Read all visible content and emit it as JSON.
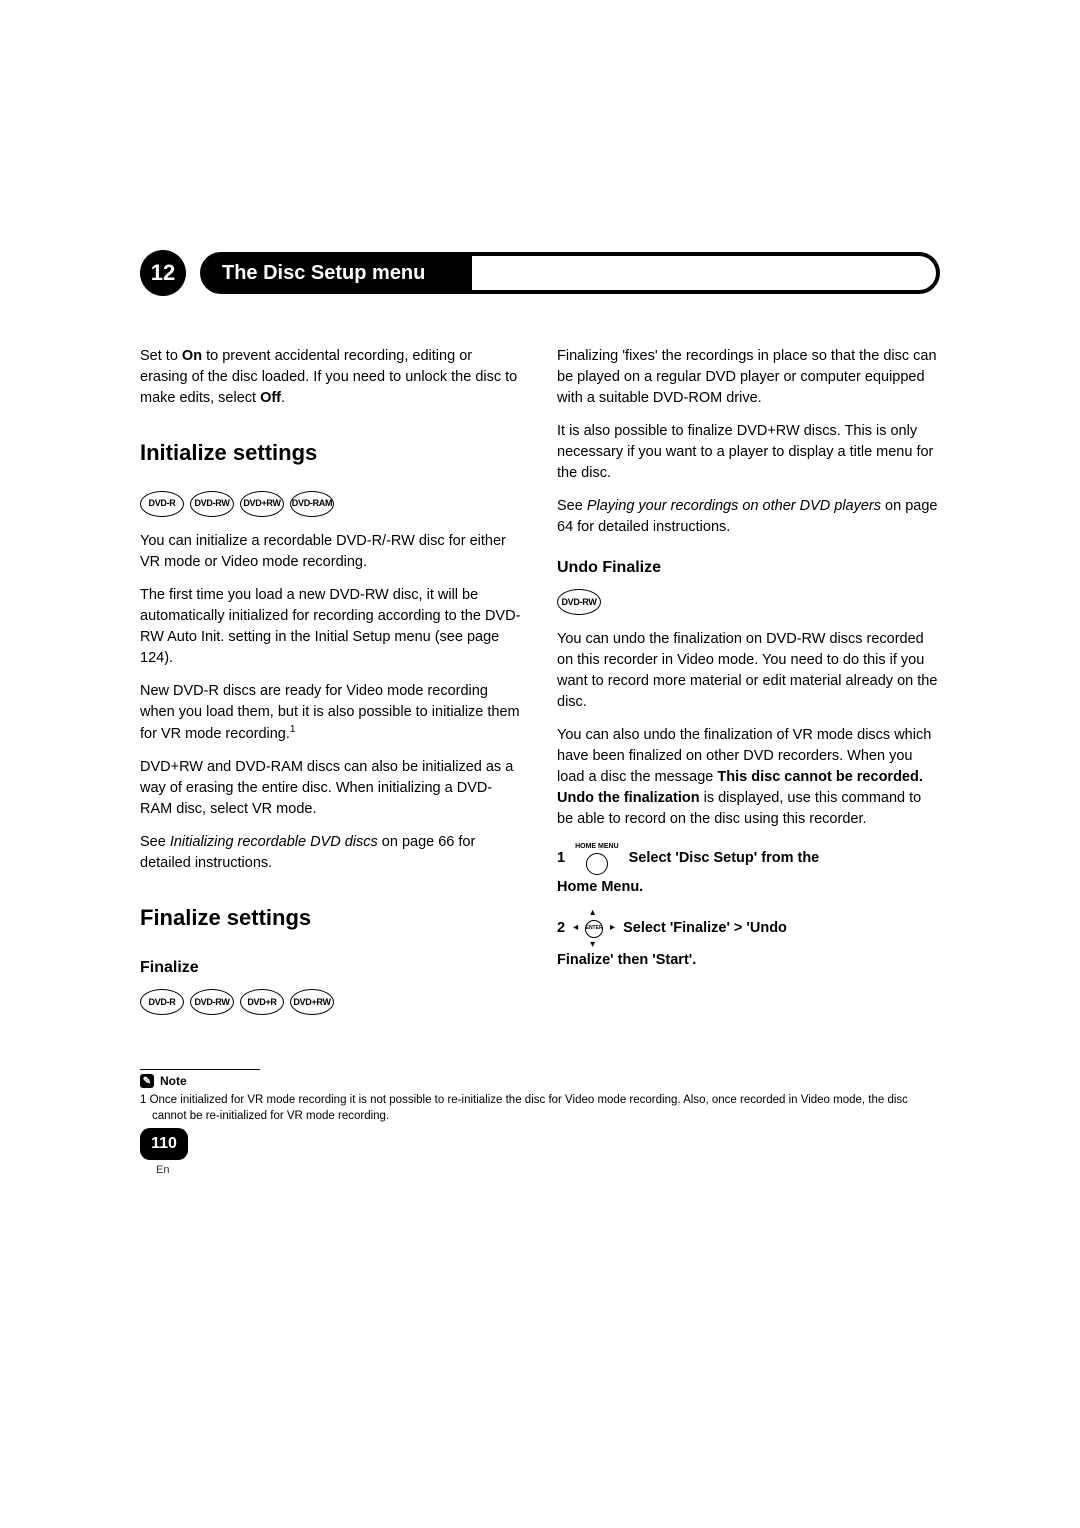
{
  "chapter": {
    "number": "12",
    "title": "The Disc Setup menu"
  },
  "left": {
    "intro_pre": "Set to ",
    "intro_on": "On",
    "intro_mid": " to prevent accidental recording, editing or erasing of the disc loaded. If you need to unlock the disc to make edits, select ",
    "intro_off": "Off",
    "intro_post": ".",
    "h_initialize": "Initialize settings",
    "init_badges": [
      "DVD-R",
      "DVD-RW",
      "DVD+RW",
      "DVD-RAM"
    ],
    "init_p1": "You can initialize a recordable DVD-R/-RW disc for either VR mode or Video mode recording.",
    "init_p2": "The first time you load a new DVD-RW disc, it will be automatically initialized for recording according to the DVD-RW Auto Init. setting in the Initial Setup menu (see page 124).",
    "init_p3_pre": "New DVD-R discs are ready for Video mode recording when you load them, but it is also possible to initialize them for VR mode recording.",
    "init_p3_sup": "1",
    "init_p4": "DVD+RW and DVD-RAM discs can also be initialized as a way of erasing the entire disc. When initializing a DVD-RAM disc, select VR mode.",
    "init_see_pre": "See ",
    "init_see_em": "Initializing recordable DVD discs",
    "init_see_post": " on page 66 for detailed instructions.",
    "h_finalize": "Finalize settings",
    "h_finalize_sub": "Finalize",
    "fin_badges": [
      "DVD-R",
      "DVD-RW",
      "DVD+R",
      "DVD+RW"
    ]
  },
  "right": {
    "fin_p1": "Finalizing 'fixes' the recordings in place so that the disc can be played on a regular DVD player or computer equipped with a suitable DVD-ROM drive.",
    "fin_p2": "It is also possible to finalize DVD+RW discs. This is only necessary if you want to a player to display a title menu for the disc.",
    "fin_see_pre": "See ",
    "fin_see_em": "Playing your recordings on other DVD players",
    "fin_see_post": " on page 64 for detailed instructions.",
    "h_undo": "Undo Finalize",
    "undo_badges": [
      "DVD-RW"
    ],
    "undo_p1": "You can undo the finalization on DVD-RW discs recorded on this recorder in Video mode. You need to do this if you want to record more material or edit material already on the disc.",
    "undo_p2_pre": "You can also undo the finalization of VR mode discs which have been finalized on other DVD recorders. When you load a disc the message ",
    "undo_p2_bold": "This disc cannot be recorded. Undo the finalization",
    "undo_p2_post": " is displayed, use this command to be able to record on the disc using this recorder.",
    "step1_num": "1",
    "step1_iconlabel": "HOME MENU",
    "step1_text": "Select 'Disc Setup' from the",
    "step1_follow": "Home Menu.",
    "step2_num": "2",
    "step2_center": "ENTER",
    "step2_text": "Select 'Finalize' > 'Undo",
    "step2_follow": "Finalize' then 'Start'."
  },
  "footnote": {
    "label": "Note",
    "text": "1  Once initialized for VR mode recording it is not possible to re-initialize the disc for Video mode recording. Also, once recorded in Video mode, the disc cannot be re-initialized for VR mode recording."
  },
  "page_number": "110",
  "lang": "En"
}
